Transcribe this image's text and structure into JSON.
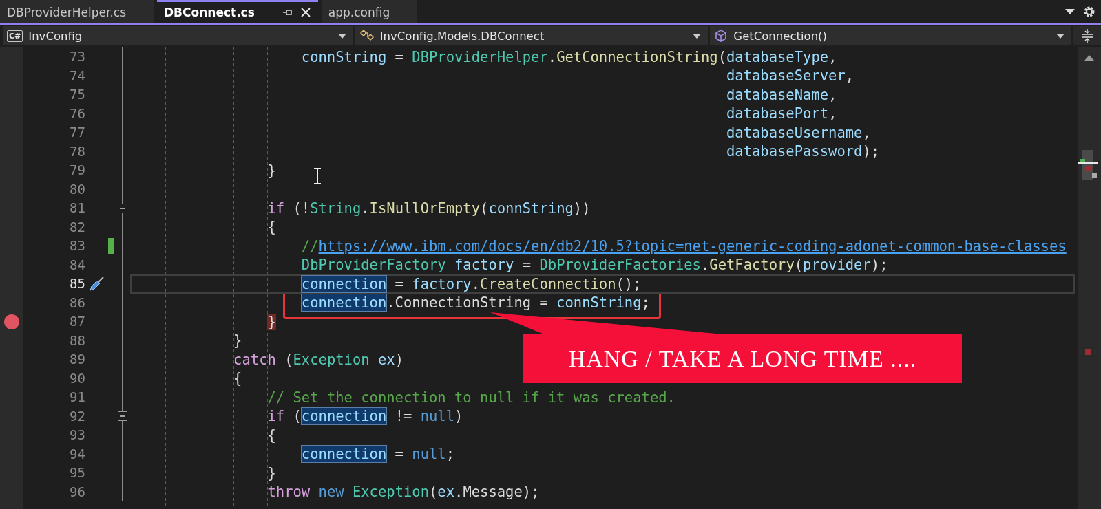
{
  "tabs": [
    {
      "label": "DBProviderHelper.cs",
      "selected": false
    },
    {
      "label": "DBConnect.cs",
      "selected": true
    },
    {
      "label": "app.config",
      "selected": false
    }
  ],
  "navigation": {
    "project": {
      "badge": "C#",
      "label": "InvConfig"
    },
    "type": {
      "label": "InvConfig.Models.DBConnect"
    },
    "member": {
      "label": "GetConnection()"
    }
  },
  "lines": [
    {
      "number": "73",
      "current": false,
      "breakpoint": false,
      "changed": false,
      "foldable": false,
      "quick_action": false,
      "tokens": [
        {
          "kind": "variable",
          "text": "                    connString"
        },
        {
          "kind": "plain",
          "text": " = "
        },
        {
          "kind": "type",
          "text": "DBProviderHelper"
        },
        {
          "kind": "plain",
          "text": "."
        },
        {
          "kind": "method",
          "text": "GetConnectionString"
        },
        {
          "kind": "plain",
          "text": "("
        },
        {
          "kind": "variable",
          "text": "databaseType"
        },
        {
          "kind": "plain",
          "text": ","
        }
      ]
    },
    {
      "number": "74",
      "current": false,
      "breakpoint": false,
      "changed": false,
      "foldable": false,
      "quick_action": false,
      "tokens": [
        {
          "kind": "variable",
          "text": "                                                                      databaseServer"
        },
        {
          "kind": "plain",
          "text": ","
        }
      ]
    },
    {
      "number": "75",
      "current": false,
      "breakpoint": false,
      "changed": false,
      "foldable": false,
      "quick_action": false,
      "tokens": [
        {
          "kind": "variable",
          "text": "                                                                      databaseName"
        },
        {
          "kind": "plain",
          "text": ","
        }
      ]
    },
    {
      "number": "76",
      "current": false,
      "breakpoint": false,
      "changed": false,
      "foldable": false,
      "quick_action": false,
      "tokens": [
        {
          "kind": "variable",
          "text": "                                                                      databasePort"
        },
        {
          "kind": "plain",
          "text": ","
        }
      ]
    },
    {
      "number": "77",
      "current": false,
      "breakpoint": false,
      "changed": false,
      "foldable": false,
      "quick_action": false,
      "tokens": [
        {
          "kind": "variable",
          "text": "                                                                      databaseUsername"
        },
        {
          "kind": "plain",
          "text": ","
        }
      ]
    },
    {
      "number": "78",
      "current": false,
      "breakpoint": false,
      "changed": false,
      "foldable": false,
      "quick_action": false,
      "tokens": [
        {
          "kind": "variable",
          "text": "                                                                      databasePassword"
        },
        {
          "kind": "plain",
          "text": ");"
        }
      ]
    },
    {
      "number": "79",
      "current": false,
      "breakpoint": false,
      "changed": false,
      "foldable": false,
      "quick_action": false,
      "tokens": [
        {
          "kind": "plain",
          "text": "                }"
        }
      ]
    },
    {
      "number": "80",
      "current": false,
      "breakpoint": false,
      "changed": false,
      "foldable": false,
      "quick_action": false
    },
    {
      "number": "81",
      "current": false,
      "breakpoint": false,
      "changed": false,
      "foldable": true,
      "quick_action": false,
      "tokens": [
        {
          "kind": "keyword",
          "text": "                if"
        },
        {
          "kind": "plain",
          "text": " (!"
        },
        {
          "kind": "type",
          "text": "String"
        },
        {
          "kind": "plain",
          "text": "."
        },
        {
          "kind": "method",
          "text": "IsNullOrEmpty"
        },
        {
          "kind": "plain",
          "text": "("
        },
        {
          "kind": "variable",
          "text": "connString"
        },
        {
          "kind": "plain",
          "text": "))"
        }
      ]
    },
    {
      "number": "82",
      "current": false,
      "breakpoint": false,
      "changed": false,
      "foldable": false,
      "quick_action": false,
      "tokens": [
        {
          "kind": "plain",
          "text": "                {"
        }
      ]
    },
    {
      "number": "83",
      "current": false,
      "breakpoint": false,
      "changed": true,
      "foldable": false,
      "quick_action": false,
      "tokens": [
        {
          "kind": "comment",
          "text": "                    //"
        },
        {
          "kind": "link",
          "text": "https://www.ibm.com/docs/en/db2/10.5?topic=net-generic-coding-adonet-common-base-classes"
        }
      ]
    },
    {
      "number": "84",
      "current": false,
      "breakpoint": false,
      "changed": false,
      "foldable": false,
      "quick_action": false,
      "tokens": [
        {
          "kind": "type",
          "text": "                    DbProviderFactory"
        },
        {
          "kind": "variable",
          "text": " factory"
        },
        {
          "kind": "plain",
          "text": " = "
        },
        {
          "kind": "type",
          "text": "DbProviderFactories"
        },
        {
          "kind": "plain",
          "text": "."
        },
        {
          "kind": "method",
          "text": "GetFactory"
        },
        {
          "kind": "plain",
          "text": "("
        },
        {
          "kind": "variable",
          "text": "provider"
        },
        {
          "kind": "plain",
          "text": ");"
        }
      ]
    },
    {
      "number": "85",
      "current": true,
      "breakpoint": false,
      "changed": false,
      "foldable": false,
      "quick_action": true,
      "tokens": [
        {
          "kind": "reference",
          "text": "                    connection"
        },
        {
          "kind": "plain",
          "text": " = "
        },
        {
          "kind": "variable",
          "text": "factory"
        },
        {
          "kind": "plain",
          "text": "."
        },
        {
          "kind": "method",
          "text": "CreateConnection"
        },
        {
          "kind": "plain",
          "text": "();"
        }
      ]
    },
    {
      "number": "86",
      "current": false,
      "breakpoint": false,
      "changed": false,
      "foldable": false,
      "quick_action": false,
      "tokens": [
        {
          "kind": "reference",
          "text": "                    connection"
        },
        {
          "kind": "plain",
          "text": ".ConnectionString = "
        },
        {
          "kind": "variable",
          "text": "connString"
        },
        {
          "kind": "plain",
          "text": ";"
        }
      ]
    },
    {
      "number": "87",
      "current": false,
      "breakpoint": true,
      "changed": false,
      "foldable": false,
      "quick_action": false,
      "tokens": [
        {
          "kind": "brace_match",
          "text": "                }"
        }
      ]
    },
    {
      "number": "88",
      "current": false,
      "breakpoint": false,
      "changed": false,
      "foldable": false,
      "quick_action": false,
      "tokens": [
        {
          "kind": "plain",
          "text": "            }"
        }
      ]
    },
    {
      "number": "89",
      "current": false,
      "breakpoint": false,
      "changed": false,
      "foldable": false,
      "quick_action": false,
      "tokens": [
        {
          "kind": "keyword",
          "text": "            catch"
        },
        {
          "kind": "plain",
          "text": " ("
        },
        {
          "kind": "type",
          "text": "Exception"
        },
        {
          "kind": "variable",
          "text": " ex"
        },
        {
          "kind": "plain",
          "text": ")"
        }
      ]
    },
    {
      "number": "90",
      "current": false,
      "breakpoint": false,
      "changed": false,
      "foldable": false,
      "quick_action": false,
      "tokens": [
        {
          "kind": "plain",
          "text": "            {"
        }
      ]
    },
    {
      "number": "91",
      "current": false,
      "breakpoint": false,
      "changed": false,
      "foldable": false,
      "quick_action": false,
      "tokens": [
        {
          "kind": "comment",
          "text": "                // Set the connection to null if it was created."
        }
      ]
    },
    {
      "number": "92",
      "current": false,
      "breakpoint": false,
      "changed": false,
      "foldable": true,
      "quick_action": false,
      "tokens": [
        {
          "kind": "keyword",
          "text": "                if"
        },
        {
          "kind": "plain",
          "text": " ("
        },
        {
          "kind": "reference",
          "text": "connection"
        },
        {
          "kind": "plain",
          "text": " != "
        },
        {
          "kind": "literal",
          "text": "null"
        },
        {
          "kind": "plain",
          "text": ")"
        }
      ]
    },
    {
      "number": "93",
      "current": false,
      "breakpoint": false,
      "changed": false,
      "foldable": false,
      "quick_action": false,
      "tokens": [
        {
          "kind": "plain",
          "text": "                {"
        }
      ]
    },
    {
      "number": "94",
      "current": false,
      "breakpoint": false,
      "changed": false,
      "foldable": false,
      "quick_action": false,
      "tokens": [
        {
          "kind": "reference",
          "text": "                    connection"
        },
        {
          "kind": "plain",
          "text": " = "
        },
        {
          "kind": "literal",
          "text": "null"
        },
        {
          "kind": "plain",
          "text": ";"
        }
      ]
    },
    {
      "number": "95",
      "current": false,
      "breakpoint": false,
      "changed": false,
      "foldable": false,
      "quick_action": false,
      "tokens": [
        {
          "kind": "plain",
          "text": "                }"
        }
      ]
    },
    {
      "number": "96",
      "current": false,
      "breakpoint": false,
      "changed": false,
      "foldable": false,
      "quick_action": false,
      "tokens": [
        {
          "kind": "keyword",
          "text": "                throw"
        },
        {
          "kind": "literal",
          "text": " new"
        },
        {
          "kind": "type",
          "text": " Exception"
        },
        {
          "kind": "plain",
          "text": "("
        },
        {
          "kind": "variable",
          "text": "ex"
        },
        {
          "kind": "plain",
          "text": ".Message);"
        }
      ]
    }
  ],
  "annotation": {
    "text": "HANG / TAKE A LONG TIME ...."
  }
}
